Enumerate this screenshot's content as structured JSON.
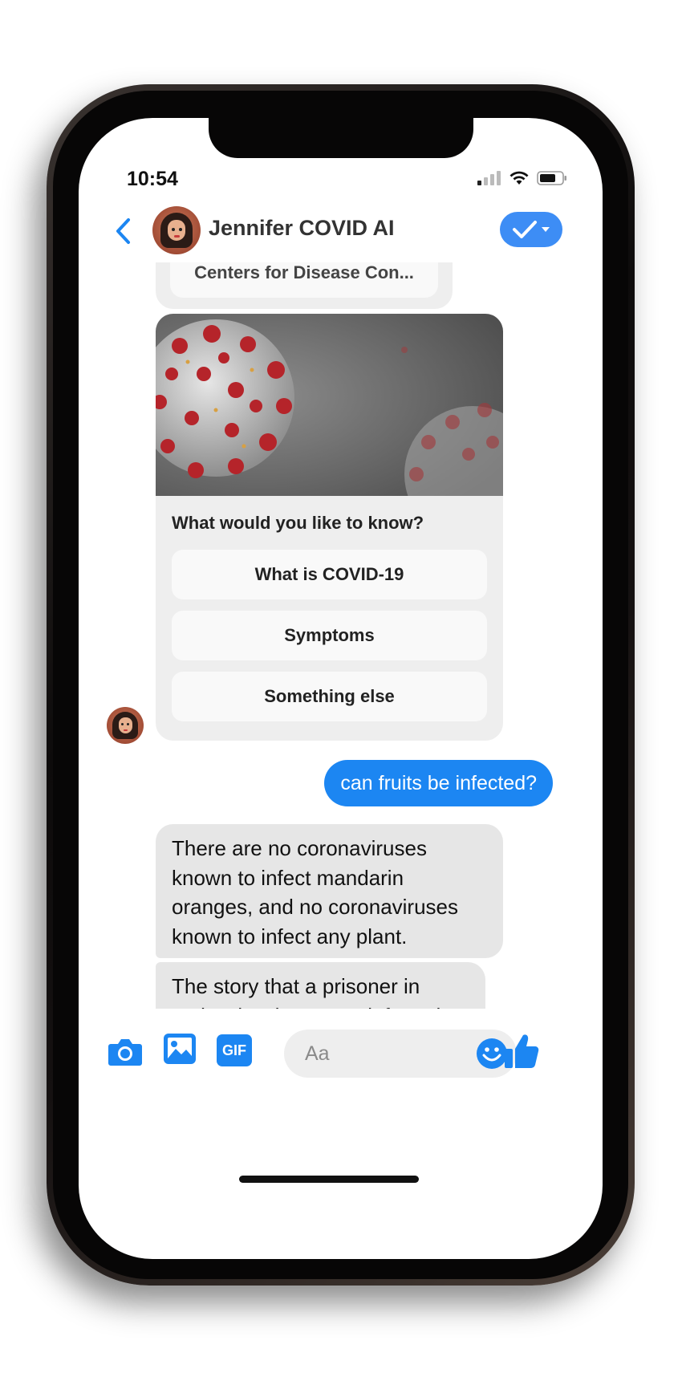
{
  "status_bar": {
    "time": "10:54"
  },
  "header": {
    "contact_name": "Jennifer COVID AI",
    "back_icon": "chevron-left-icon",
    "verify_icon": "checkmark-icon"
  },
  "messages": {
    "link_card_title": "Centers for Disease Con...",
    "card_question": "What would you like to know?",
    "quick_replies": [
      "What is COVID-19",
      "Symptoms",
      "Something else"
    ],
    "user_message": "can fruits be infected?",
    "bot_messages": [
      "There are no coronaviruses known to infect mandarin oranges, and no coronaviruses known to infect any plant.",
      "The story that a prisoner in Malaysia who ate an infected mandarin orange and died shortly is false."
    ]
  },
  "composer": {
    "placeholder": "Aa",
    "icons": [
      "camera-icon",
      "image-icon",
      "gif-icon",
      "emoji-icon",
      "thumbs-up-icon"
    ],
    "gif_label": "GIF"
  },
  "colors": {
    "accent": "#1c86f2",
    "bot_bubble": "#e6e6e6",
    "card_bg": "#eeeeee"
  }
}
